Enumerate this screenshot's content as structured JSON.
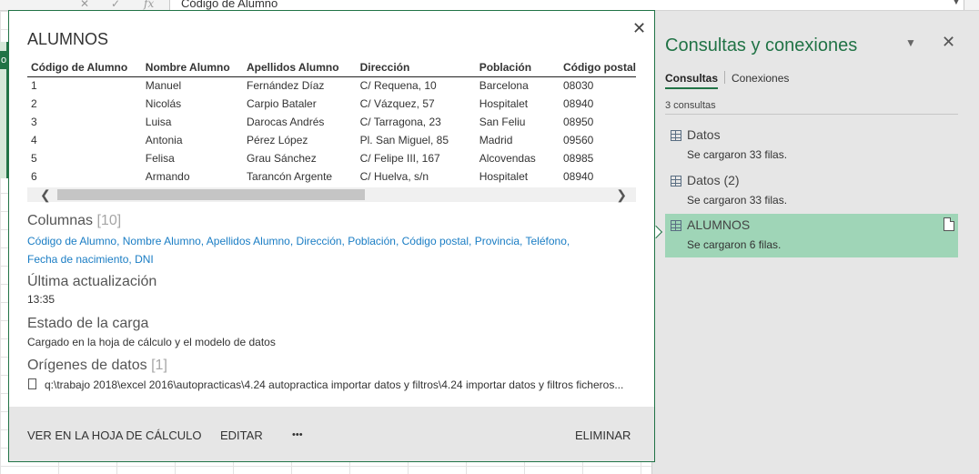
{
  "formula_bar": {
    "cancel_icon": "✕",
    "enter_icon": "✓",
    "fx_label": "fx",
    "value": "Código de Alumno"
  },
  "sheet": {
    "col_label": "o"
  },
  "pane": {
    "title": "Consultas y conexiones",
    "tabs": [
      "Consultas",
      "Conexiones"
    ],
    "count_text": "3 consultas",
    "queries": [
      {
        "name": "Datos",
        "status": "Se cargaron 33 filas."
      },
      {
        "name": "Datos (2)",
        "status": "Se cargaron 33 filas."
      },
      {
        "name": "ALUMNOS",
        "status": "Se cargaron 6 filas."
      }
    ]
  },
  "card": {
    "title": "ALUMNOS",
    "table": {
      "headers": [
        "Código de Alumno",
        "Nombre Alumno",
        "Apellidos Alumno",
        "Dirección",
        "Población",
        "Código postal"
      ],
      "rows": [
        [
          "1",
          "Manuel",
          "Fernández Díaz",
          "C/ Requena, 10",
          "Barcelona",
          "08030"
        ],
        [
          "2",
          "Nicolás",
          "Carpio Bataler",
          "C/ Vázquez, 57",
          "Hospitalet",
          "08940"
        ],
        [
          "3",
          "Luisa",
          "Darocas Andrés",
          "C/ Tarragona, 23",
          "San Feliu",
          "08950"
        ],
        [
          "4",
          "Antonia",
          "Pérez López",
          "Pl. San Miguel, 85",
          "Madrid",
          "09560"
        ],
        [
          "5",
          "Felisa",
          "Grau Sánchez",
          "C/ Felipe III, 167",
          "Alcovendas",
          "08985"
        ],
        [
          "6",
          "Armando",
          "Tarancón Argente",
          "C/ Huelva, s/n",
          "Hospitalet",
          "08940"
        ]
      ]
    },
    "columns_heading": "Columnas",
    "columns_count": "[10]",
    "columns": [
      "Código de Alumno,",
      "Nombre Alumno,",
      "Apellidos Alumno,",
      "Dirección,",
      "Población,",
      "Código postal,",
      "Provincia,",
      "Teléfono,",
      "Fecha de nacimiento,",
      "DNI"
    ],
    "last_update_heading": "Última actualización",
    "last_update_value": "13:35",
    "load_state_heading": "Estado de la carga",
    "load_state_value": "Cargado en la hoja de cálculo y el modelo de datos",
    "sources_heading": "Orígenes de datos",
    "sources_count": "[1]",
    "source_path": "q:\\trabajo 2018\\excel 2016\\autopracticas\\4.24 autopractica importar datos y filtros\\4.24 importar datos y filtros ficheros...",
    "footer": {
      "view_label": "VER EN LA HOJA DE CÁLCULO",
      "edit_label": "EDITAR",
      "more_label": "•••",
      "delete_label": "ELIMINAR"
    }
  }
}
